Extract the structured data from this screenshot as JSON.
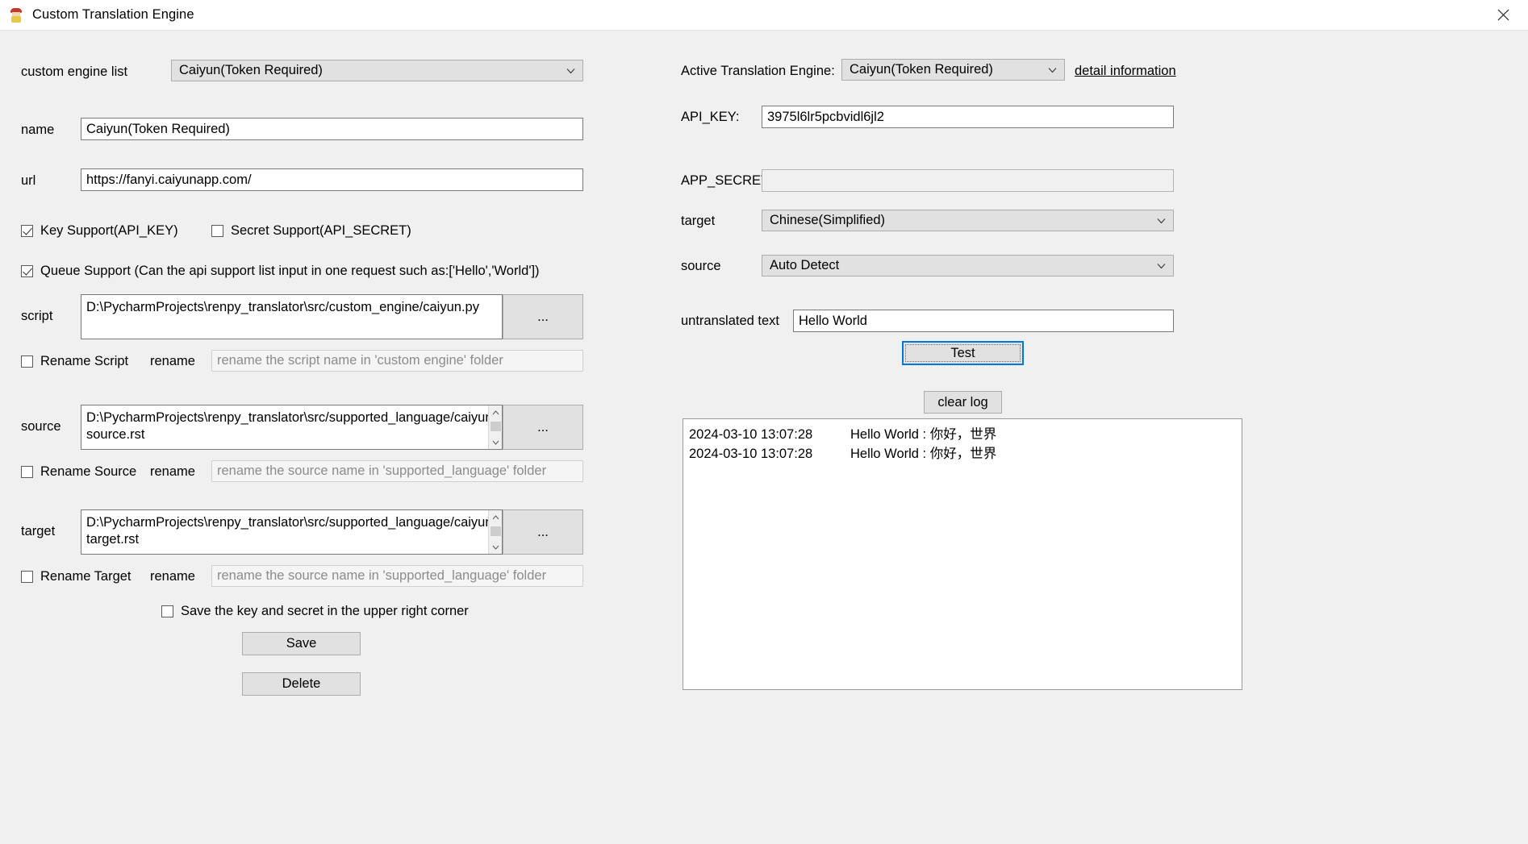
{
  "window": {
    "title": "Custom Translation Engine",
    "icon": "app-icon",
    "close_icon": "close-icon"
  },
  "left": {
    "custom_engine_list_label": "custom engine list",
    "custom_engine_list_value": "Caiyun(Token Required)",
    "name_label": "name",
    "name_value": "Caiyun(Token Required)",
    "url_label": "url",
    "url_value": "https://fanyi.caiyunapp.com/",
    "key_support_label": "Key Support(API_KEY)",
    "key_support_checked": true,
    "secret_support_label": "Secret Support(API_SECRET)",
    "secret_support_checked": false,
    "queue_support_label": "Queue Support (Can the api support list input in one request such as:['Hello','World'])",
    "queue_support_checked": true,
    "script_label": "script",
    "script_value": "D:\\PycharmProjects\\renpy_translator\\src/custom_engine/caiyun.py",
    "script_browse_label": "...",
    "rename_script_label": "Rename Script",
    "rename_script_checked": false,
    "rename_script_rename_label": "rename",
    "rename_script_placeholder": "rename the  script name in  'custom engine' folder",
    "source_label": "source",
    "source_value": "D:\\PycharmProjects\\renpy_translator\\src/supported_language/caiyun.source.rst",
    "source_browse_label": "...",
    "rename_source_label": "Rename Source",
    "rename_source_checked": false,
    "rename_source_rename_label": "rename",
    "rename_source_placeholder": "rename the  source name in  'supported_language' folder",
    "target_label": "target",
    "target_value": "D:\\PycharmProjects\\renpy_translator\\src/supported_language/caiyun.target.rst",
    "target_browse_label": "...",
    "rename_target_label": "Rename Target",
    "rename_target_checked": false,
    "rename_target_rename_label": "rename",
    "rename_target_placeholder": "rename the  source name in  'supported_language' folder",
    "save_key_secret_label": "Save the key and secret in the upper right corner",
    "save_key_secret_checked": false,
    "save_button": "Save",
    "delete_button": "Delete"
  },
  "right": {
    "active_engine_label": "Active Translation Engine:",
    "active_engine_value": "Caiyun(Token Required)",
    "detail_information_link": "detail information",
    "api_key_label": "API_KEY:",
    "api_key_value": "3975l6lr5pcbvidl6jl2",
    "app_secret_label": "APP_SECRET:",
    "app_secret_value": "",
    "target_label": "target",
    "target_value": "Chinese(Simplified)",
    "source_label": "source",
    "source_value": "Auto Detect",
    "untranslated_text_label": "untranslated text",
    "untranslated_text_value": "Hello World",
    "test_button": "Test",
    "clear_log_button": "clear log",
    "log_rows": [
      {
        "timestamp": "2024-03-10 13:07:28",
        "message": "Hello World : 你好，世界"
      },
      {
        "timestamp": "2024-03-10 13:07:28",
        "message": "Hello World : 你好，世界"
      }
    ]
  },
  "colors": {
    "window_bg": "#f0f0f0",
    "titlebar_bg": "#ffffff",
    "control_bg": "#e1e1e1",
    "field_bg": "#ffffff",
    "focus_blue": "#0078d7",
    "placeholder_text": "#8c8c8c"
  }
}
